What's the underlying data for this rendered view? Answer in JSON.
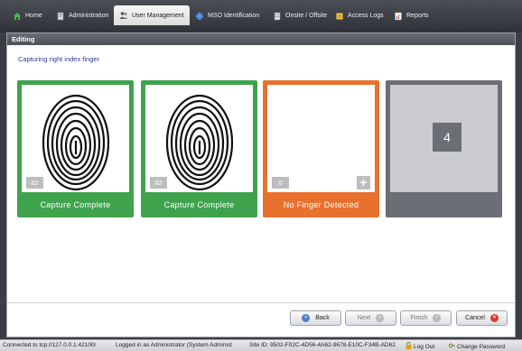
{
  "nav": {
    "tabs": [
      {
        "label": "Home",
        "icon": "home-icon"
      },
      {
        "label": "Administration",
        "icon": "server-icon"
      },
      {
        "label": "User Management",
        "icon": "users-icon"
      },
      {
        "label": "MSO Identification",
        "icon": "globe-icon"
      },
      {
        "label": "Onsite / Offsite",
        "icon": "building-icon"
      },
      {
        "label": "Access Logs",
        "icon": "log-icon"
      },
      {
        "label": "Reports",
        "icon": "reports-icon"
      }
    ],
    "active": "User Management"
  },
  "panel": {
    "title": "Editing",
    "instruction": "Capturing right index finger"
  },
  "cards": [
    {
      "status": "Capture Complete",
      "score": "82",
      "state": "complete",
      "color": "#3fa34d"
    },
    {
      "status": "Capture Complete",
      "score": "82",
      "state": "complete",
      "color": "#3fa34d"
    },
    {
      "status": "No Finger Detected",
      "score": "0",
      "state": "error",
      "color": "#e8712d"
    },
    {
      "number": "4",
      "state": "pending",
      "color": "#6b6e74"
    }
  ],
  "buttons": {
    "back": "Back",
    "next": "Next",
    "finish": "Finish",
    "cancel": "Cancel"
  },
  "status_bar": {
    "connection": "Connected to tcp://127.0.0.1:42100/",
    "user": "Logged in as Administrator (System Administ",
    "site": "Site ID: 9502-F02C-4D56-4A62-9678-E10C-F34B-AD62",
    "logout": "Log Out",
    "change_password": "Change Password"
  }
}
